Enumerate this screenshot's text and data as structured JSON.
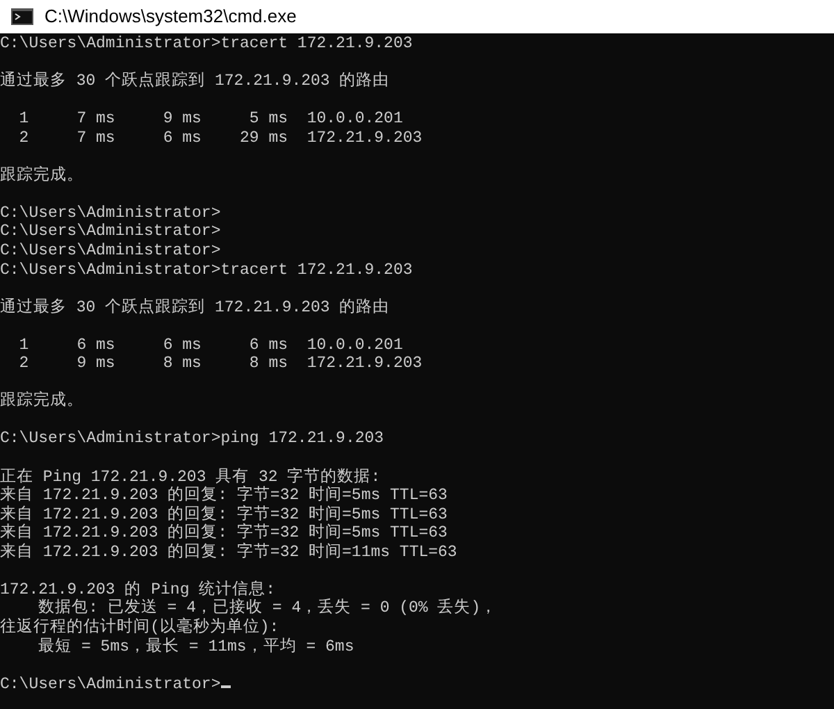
{
  "window": {
    "title": "C:\\Windows\\system32\\cmd.exe"
  },
  "console": {
    "blocks": [
      {
        "lines": [
          "C:\\Users\\Administrator>tracert 172.21.9.203"
        ]
      },
      {
        "lines": [
          "通过最多 30 个跃点跟踪到 172.21.9.203 的路由"
        ]
      },
      {
        "lines": [
          "  1     7 ms     9 ms     5 ms  10.0.0.201",
          "  2     7 ms     6 ms    29 ms  172.21.9.203"
        ]
      },
      {
        "lines": [
          "跟踪完成。"
        ]
      },
      {
        "lines": [
          "C:\\Users\\Administrator>",
          "C:\\Users\\Administrator>",
          "C:\\Users\\Administrator>",
          "C:\\Users\\Administrator>tracert 172.21.9.203"
        ]
      },
      {
        "lines": [
          "通过最多 30 个跃点跟踪到 172.21.9.203 的路由"
        ]
      },
      {
        "lines": [
          "  1     6 ms     6 ms     6 ms  10.0.0.201",
          "  2     9 ms     8 ms     8 ms  172.21.9.203"
        ]
      },
      {
        "lines": [
          "跟踪完成。"
        ]
      },
      {
        "lines": [
          "C:\\Users\\Administrator>ping 172.21.9.203"
        ]
      },
      {
        "lines": [
          "正在 Ping 172.21.9.203 具有 32 字节的数据:",
          "来自 172.21.9.203 的回复: 字节=32 时间=5ms TTL=63",
          "来自 172.21.9.203 的回复: 字节=32 时间=5ms TTL=63",
          "来自 172.21.9.203 的回复: 字节=32 时间=5ms TTL=63",
          "来自 172.21.9.203 的回复: 字节=32 时间=11ms TTL=63"
        ]
      },
      {
        "lines": [
          "172.21.9.203 的 Ping 统计信息:",
          "    数据包: 已发送 = 4，已接收 = 4，丢失 = 0 (0% 丢失)，",
          "往返行程的估计时间(以毫秒为单位):",
          "    最短 = 5ms，最长 = 11ms，平均 = 6ms"
        ]
      },
      {
        "lines": [
          "C:\\Users\\Administrator>"
        ],
        "cursor": true
      }
    ]
  }
}
